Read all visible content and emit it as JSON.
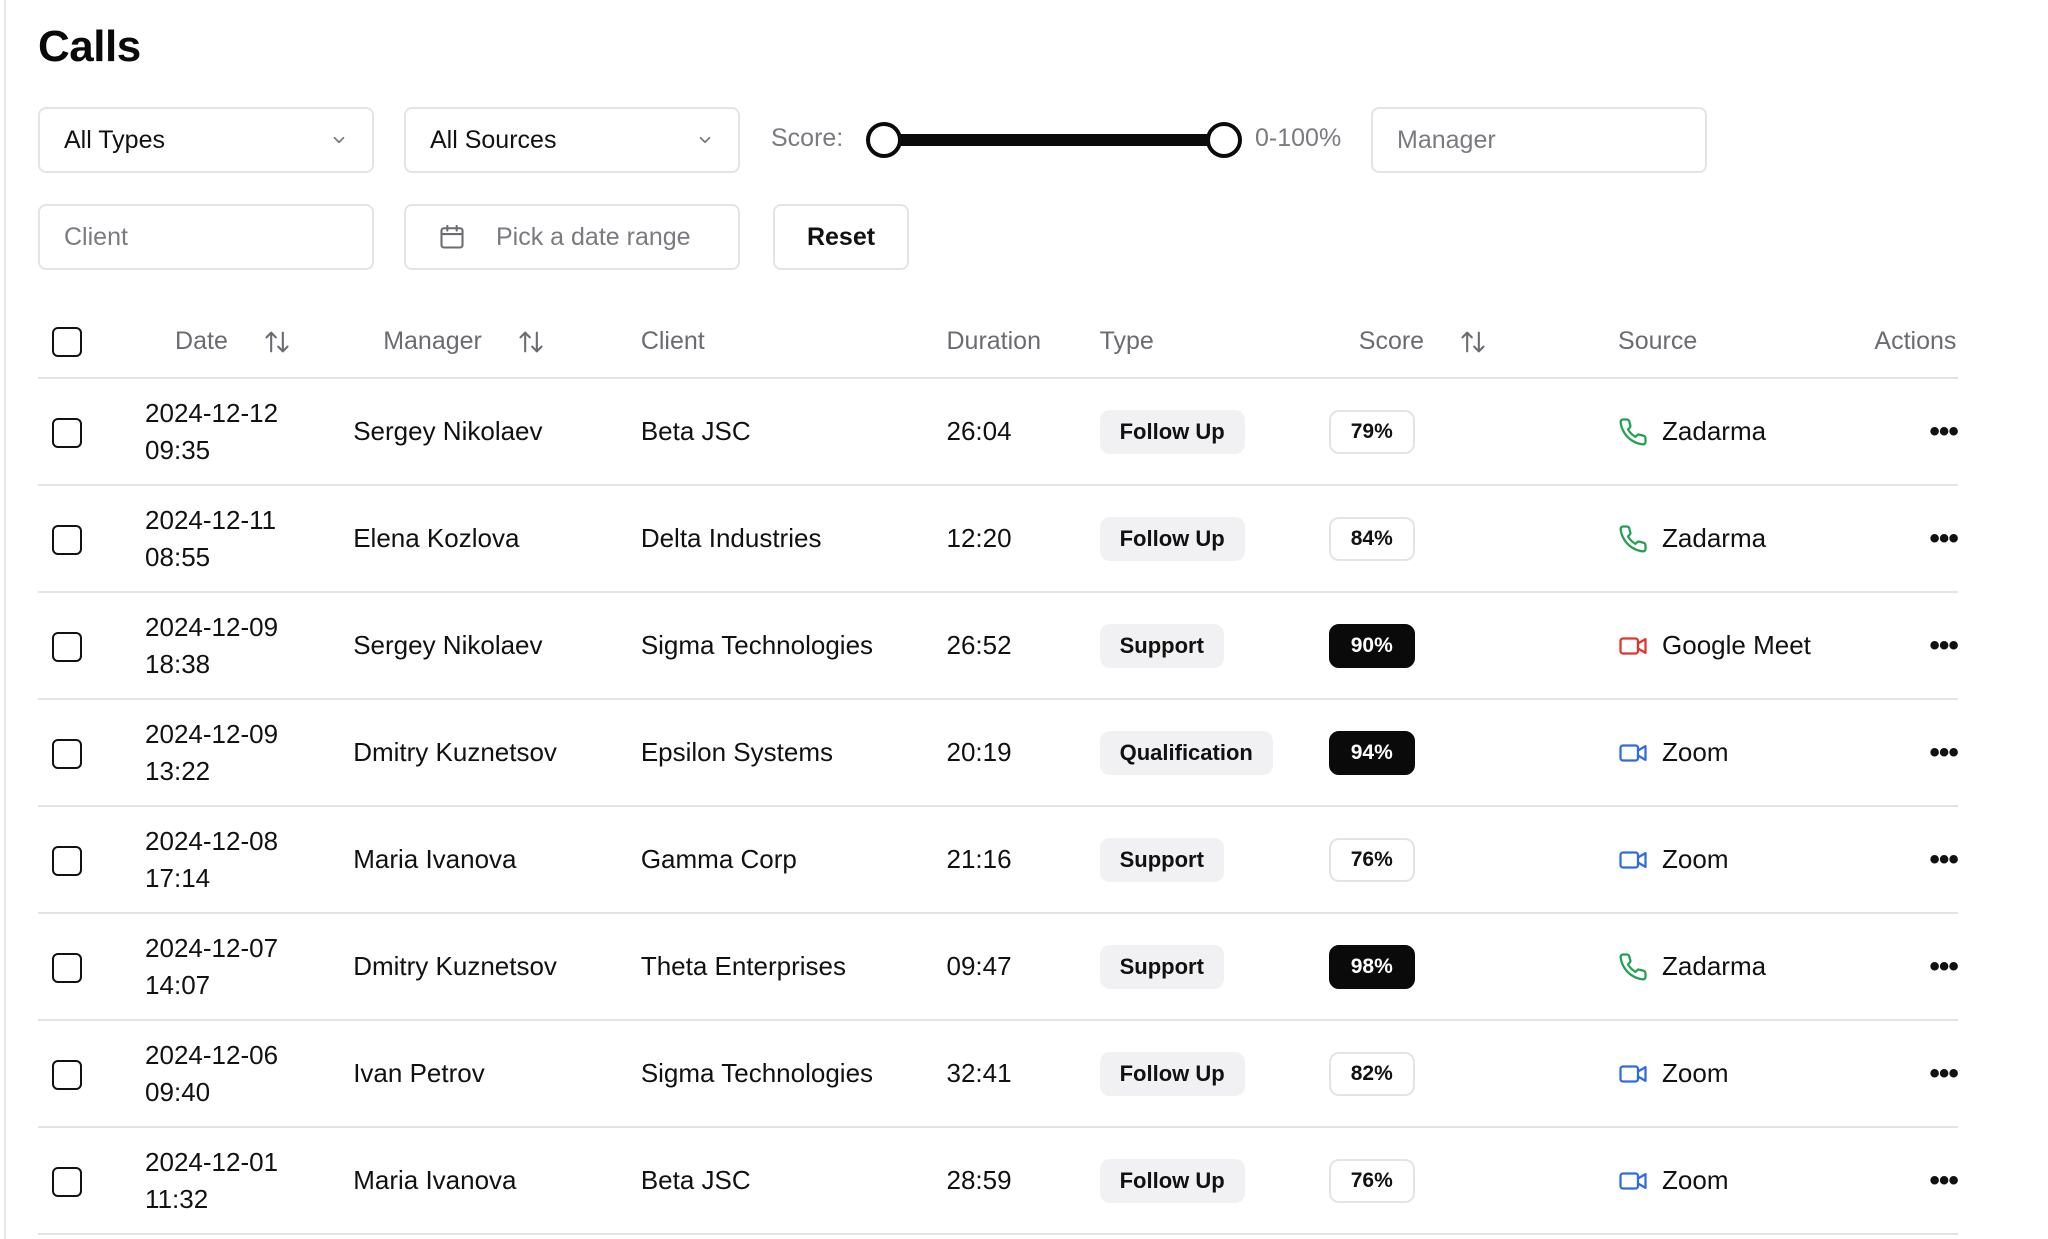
{
  "page": {
    "title": "Calls"
  },
  "filters": {
    "type_select": "All Types",
    "source_select": "All Sources",
    "score_label": "Score:",
    "score_range": "0-100%",
    "score_min": 0,
    "score_max": 100,
    "manager_placeholder": "Manager",
    "client_placeholder": "Client",
    "date_placeholder": "Pick a date range",
    "reset_label": "Reset"
  },
  "table": {
    "columns": {
      "date": "Date",
      "manager": "Manager",
      "client": "Client",
      "duration": "Duration",
      "type": "Type",
      "score": "Score",
      "source": "Source",
      "actions": "Actions"
    },
    "rows": [
      {
        "date": "2024-12-12",
        "time": "09:35",
        "manager": "Sergey Nikolaev",
        "client": "Beta JSC",
        "duration": "26:04",
        "type": "Follow Up",
        "score": "79%",
        "score_style": "light",
        "source": "Zadarma",
        "source_icon": "phone-icon"
      },
      {
        "date": "2024-12-11",
        "time": "08:55",
        "manager": "Elena Kozlova",
        "client": "Delta Industries",
        "duration": "12:20",
        "type": "Follow Up",
        "score": "84%",
        "score_style": "light",
        "source": "Zadarma",
        "source_icon": "phone-icon"
      },
      {
        "date": "2024-12-09",
        "time": "18:38",
        "manager": "Sergey Nikolaev",
        "client": "Sigma Technologies",
        "duration": "26:52",
        "type": "Support",
        "score": "90%",
        "score_style": "dark",
        "source": "Google Meet",
        "source_icon": "video-icon"
      },
      {
        "date": "2024-12-09",
        "time": "13:22",
        "manager": "Dmitry Kuznetsov",
        "client": "Epsilon Systems",
        "duration": "20:19",
        "type": "Qualification",
        "score": "94%",
        "score_style": "dark",
        "source": "Zoom",
        "source_icon": "video-icon"
      },
      {
        "date": "2024-12-08",
        "time": "17:14",
        "manager": "Maria Ivanova",
        "client": "Gamma Corp",
        "duration": "21:16",
        "type": "Support",
        "score": "76%",
        "score_style": "light",
        "source": "Zoom",
        "source_icon": "video-icon"
      },
      {
        "date": "2024-12-07",
        "time": "14:07",
        "manager": "Dmitry Kuznetsov",
        "client": "Theta Enterprises",
        "duration": "09:47",
        "type": "Support",
        "score": "98%",
        "score_style": "dark",
        "source": "Zadarma",
        "source_icon": "phone-icon"
      },
      {
        "date": "2024-12-06",
        "time": "09:40",
        "manager": "Ivan Petrov",
        "client": "Sigma Technologies",
        "duration": "32:41",
        "type": "Follow Up",
        "score": "82%",
        "score_style": "light",
        "source": "Zoom",
        "source_icon": "video-icon"
      },
      {
        "date": "2024-12-01",
        "time": "11:32",
        "manager": "Maria Ivanova",
        "client": "Beta JSC",
        "duration": "28:59",
        "type": "Follow Up",
        "score": "76%",
        "score_style": "light",
        "source": "Zoom",
        "source_icon": "video-icon"
      }
    ]
  },
  "colors": {
    "zadarma": "#22a052",
    "google_meet": "#e0352b",
    "zoom": "#2d6cdf"
  },
  "icons": {
    "select_chevron": "chevron-down-icon",
    "date_picker": "calendar-icon",
    "sort": "sort-arrows-icon",
    "row_actions": "more-horizontal-icon"
  },
  "row_actions_glyph": "•••"
}
